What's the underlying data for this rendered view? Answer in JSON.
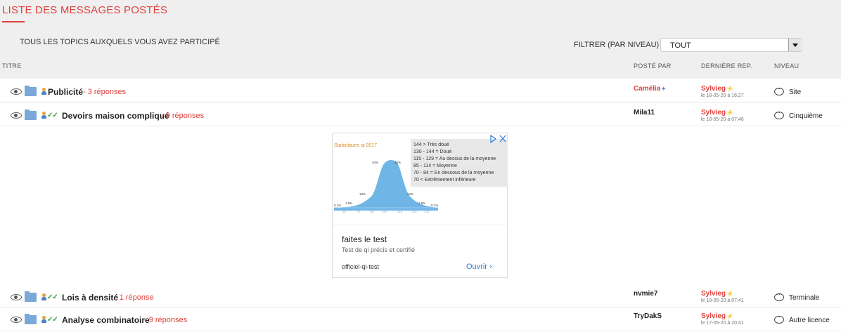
{
  "header": {
    "title": "LISTE DES MESSAGES POSTÉS",
    "subtitle": "TOUS LES TOPICS AUXQUELS VOUS AVEZ PARTICIPÉ",
    "filter_label": "FILTRER (PAR NIVEAU)",
    "filter_value": "TOUT"
  },
  "columns": {
    "title": "TITRE",
    "posted_by": "POSTÉ PAR",
    "last_reply": "DERNIÈRE REP.",
    "level": "NIVEAU"
  },
  "rows": [
    {
      "title": "Publicité",
      "replies": "- 3 réponses",
      "poster": "Camélia",
      "last_user": "Sylvieg",
      "last_date": "le 18-05-20 à 16:27",
      "level": "Site"
    },
    {
      "title": "Devoirs maison compliqué",
      "replies": "- 9 réponses",
      "poster": "Mila11",
      "last_user": "Sylvieg",
      "last_date": "le 18-05-20 à 07:46",
      "level": "Cinquième"
    },
    {
      "title": "Lois à densité",
      "replies": "- 1 réponse",
      "poster": "nvmie7",
      "last_user": "Sylvieg",
      "last_date": "le 18-05-20 à 07:41",
      "level": "Terminale"
    },
    {
      "title": "Analyse combinatoire",
      "replies": "- 9 réponses",
      "poster": "TryDakS",
      "last_user": "Sylvieg",
      "last_date": "le 17-05-20 à 20:41",
      "level": "Autre licence"
    }
  ],
  "ad": {
    "chart_title": "Statistiques qi 2017",
    "legend": [
      "144 > Très doué",
      "130 - 144 = Doué",
      "115 - 129 = Au dessus de la moyenne",
      "85 - 114 = Moyenne",
      "70 - 84 = En dessous de la moyenne",
      "70 < Extrêmement inférieure"
    ],
    "percent_labels": [
      "0.1%",
      "1.9%",
      "14%",
      "34%",
      "34%",
      "14%",
      "1.9%",
      "0.1%"
    ],
    "axis_ticks": [
      "55",
      "70",
      "85",
      "100",
      "115",
      "130",
      "145"
    ],
    "headline": "faites le test",
    "description": "Test de qi précis et certifié",
    "domain": "officiel-qi-test",
    "cta": "Ouvrir",
    "colors": {
      "curve": "#6fb6e6",
      "title": "#e08a1e"
    }
  }
}
